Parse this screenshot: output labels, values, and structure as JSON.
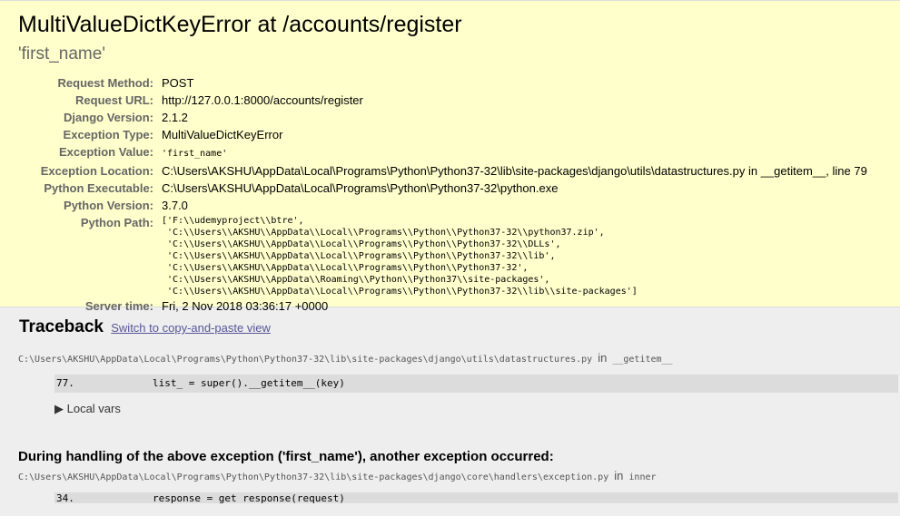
{
  "summary": {
    "title": "MultiValueDictKeyError at /accounts/register",
    "subtitle": "'first_name'",
    "rows": [
      {
        "label": "Request Method:",
        "value": "POST"
      },
      {
        "label": "Request URL:",
        "value": "http://127.0.0.1:8000/accounts/register"
      },
      {
        "label": "Django Version:",
        "value": "2.1.2"
      },
      {
        "label": "Exception Type:",
        "value": "MultiValueDictKeyError"
      },
      {
        "label": "Exception Value:",
        "value": "'first_name'"
      },
      {
        "label": "Exception Location:",
        "value": "C:\\Users\\AKSHU\\AppData\\Local\\Programs\\Python\\Python37-32\\lib\\site-packages\\django\\utils\\datastructures.py in __getitem__, line 79"
      },
      {
        "label": "Python Executable:",
        "value": "C:\\Users\\AKSHU\\AppData\\Local\\Programs\\Python\\Python37-32\\python.exe"
      },
      {
        "label": "Python Version:",
        "value": "3.7.0"
      },
      {
        "label": "Python Path:",
        "value": "['F:\\\\udemyproject\\\\btre',\n 'C:\\\\Users\\\\AKSHU\\\\AppData\\\\Local\\\\Programs\\\\Python\\\\Python37-32\\\\python37.zip',\n 'C:\\\\Users\\\\AKSHU\\\\AppData\\\\Local\\\\Programs\\\\Python\\\\Python37-32\\\\DLLs',\n 'C:\\\\Users\\\\AKSHU\\\\AppData\\\\Local\\\\Programs\\\\Python\\\\Python37-32\\\\lib',\n 'C:\\\\Users\\\\AKSHU\\\\AppData\\\\Local\\\\Programs\\\\Python\\\\Python37-32',\n 'C:\\\\Users\\\\AKSHU\\\\AppData\\\\Roaming\\\\Python\\\\Python37\\\\site-packages',\n 'C:\\\\Users\\\\AKSHU\\\\AppData\\\\Local\\\\Programs\\\\Python\\\\Python37-32\\\\lib\\\\site-packages']"
      },
      {
        "label": "Server time:",
        "value": "Fri, 2 Nov 2018 03:36:17 +0000"
      }
    ]
  },
  "traceback": {
    "heading": "Traceback",
    "switch_link": "Switch to copy-and-paste view",
    "frame1": {
      "path": "C:\\Users\\AKSHU\\AppData\\Local\\Programs\\Python\\Python37-32\\lib\\site-packages\\django\\utils\\datastructures.py",
      "in": "in",
      "func": "__getitem__",
      "context_line": "77.             list_ = super().__getitem__(key)",
      "local_vars": "▶ Local vars"
    },
    "handling_text": "During handling of the above exception ('first_name'), another exception occurred:",
    "frame2": {
      "path": "C:\\Users\\AKSHU\\AppData\\Local\\Programs\\Python\\Python37-32\\lib\\site-packages\\django\\core\\handlers\\exception.py",
      "in": "in",
      "func": "inner",
      "context_line": "34.             response = get_response(request)"
    }
  }
}
